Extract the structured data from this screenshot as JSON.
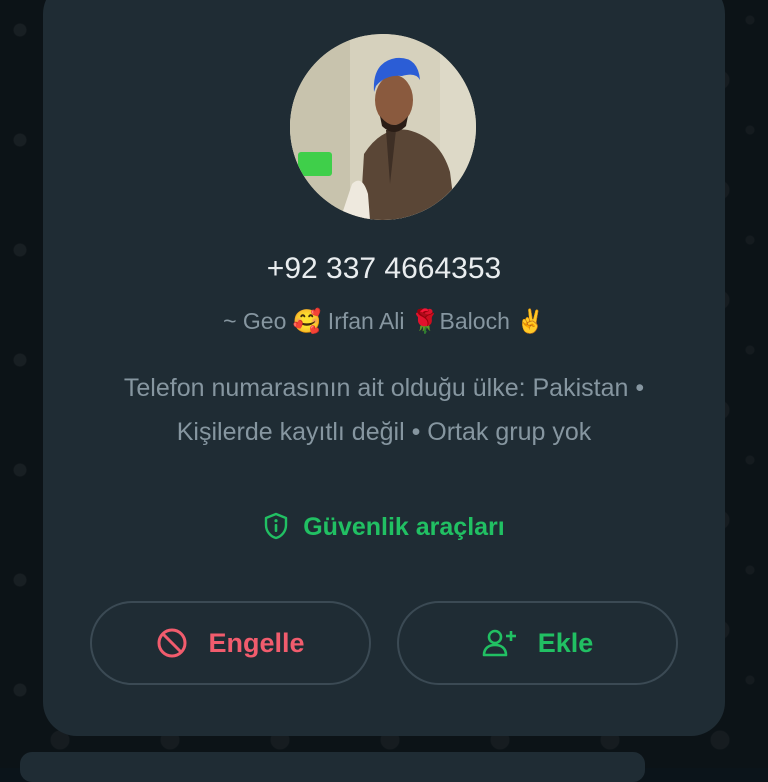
{
  "contact": {
    "phone": "+92 337 4664353",
    "push_name": "~ Geo 🥰 Irfan Ali 🌹Baloch ✌️",
    "info_text": "Telefon numarasının ait olduğu ülke: Pakistan • Kişilerde kayıtlı değil • Ortak grup yok"
  },
  "security": {
    "label": "Güvenlik araçları",
    "icon": "shield-info-icon"
  },
  "actions": {
    "block_label": "Engelle",
    "block_icon": "block-icon",
    "add_label": "Ekle",
    "add_icon": "person-add-icon"
  },
  "colors": {
    "card_background": "#1f2c34",
    "accent_green": "#21c063",
    "danger_red": "#f15c6d",
    "primary_text": "#e9edef",
    "secondary_text": "#8696a0"
  }
}
